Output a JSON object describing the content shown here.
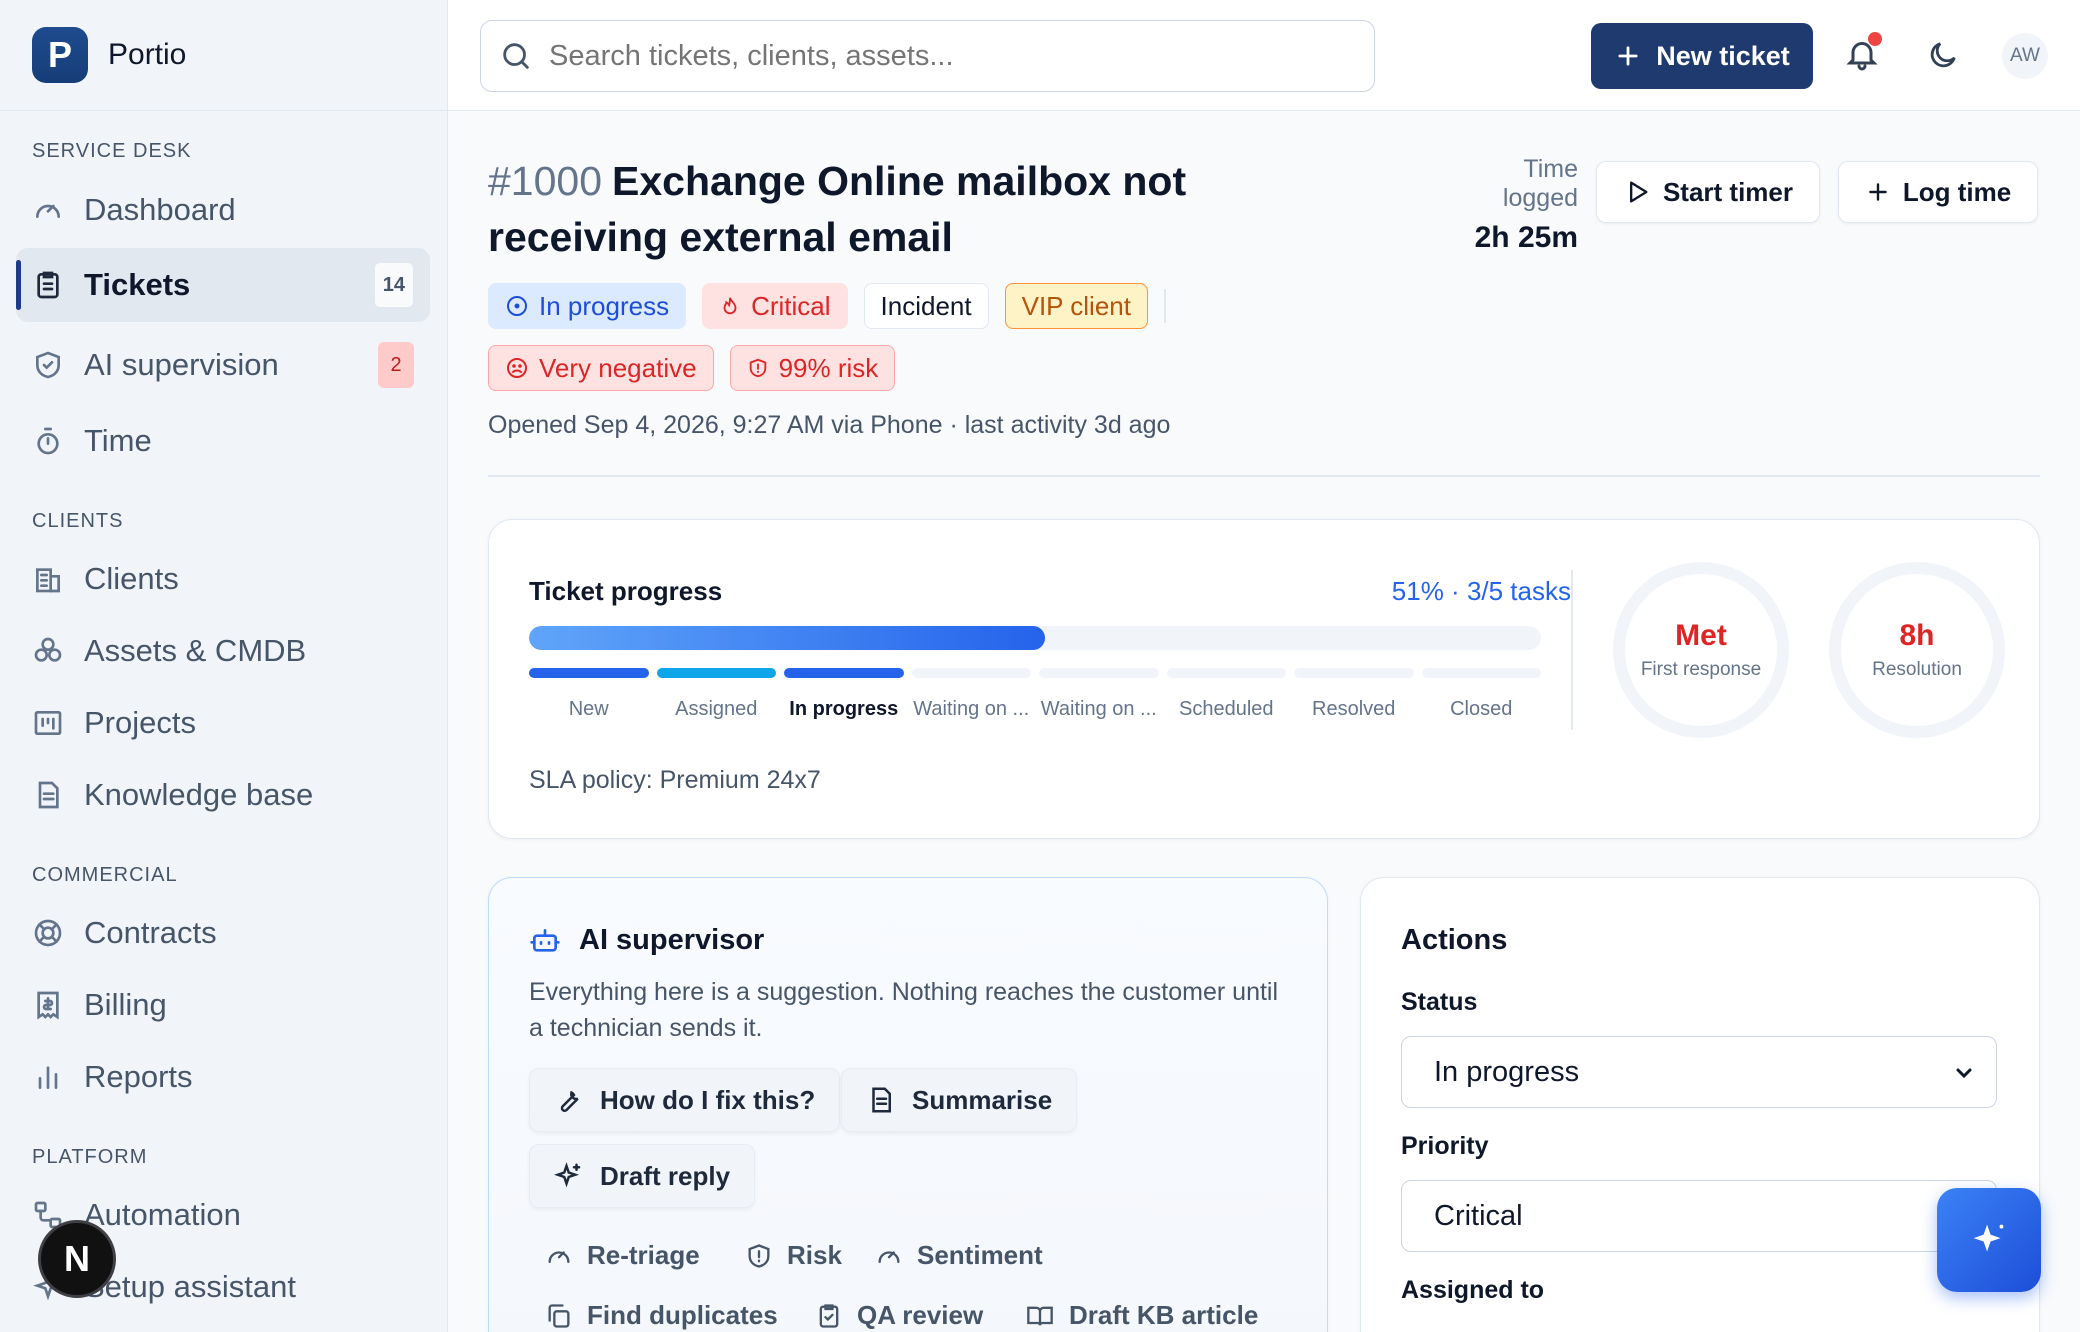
{
  "app": {
    "name": "Portio",
    "logo_letter": "P"
  },
  "sidebar": {
    "sections": [
      {
        "label": "SERVICE DESK",
        "items": [
          {
            "label": "Dashboard",
            "icon": "gauge-icon"
          },
          {
            "label": "Tickets",
            "icon": "clipboard-icon",
            "badge": "14",
            "active": true
          },
          {
            "label": "AI supervision",
            "icon": "shield-check-icon",
            "badge": "2"
          },
          {
            "label": "Time",
            "icon": "stopwatch-icon"
          }
        ]
      },
      {
        "label": "CLIENTS",
        "items": [
          {
            "label": "Clients",
            "icon": "building-icon"
          },
          {
            "label": "Assets & CMDB",
            "icon": "boxes-icon"
          },
          {
            "label": "Projects",
            "icon": "kanban-icon"
          },
          {
            "label": "Knowledge base",
            "icon": "document-icon"
          }
        ]
      },
      {
        "label": "COMMERCIAL",
        "items": [
          {
            "label": "Contracts",
            "icon": "lifebuoy-icon"
          },
          {
            "label": "Billing",
            "icon": "receipt-icon"
          },
          {
            "label": "Reports",
            "icon": "bar-chart-icon"
          }
        ]
      },
      {
        "label": "PLATFORM",
        "items": [
          {
            "label": "Automation",
            "icon": "workflow-icon"
          },
          {
            "label": "Setup assistant",
            "icon": "sparkle-icon"
          }
        ]
      }
    ],
    "user_badge": "N"
  },
  "header": {
    "search_placeholder": "Search tickets, clients, assets...",
    "new_ticket_label": "New ticket",
    "avatar_initials": "AW",
    "notification_dot_color": "#ef4444"
  },
  "ticket": {
    "number": "#1000",
    "title": "Exchange Online mailbox not receiving external email",
    "chips": {
      "status": "In progress",
      "priority": "Critical",
      "type": "Incident",
      "client_tier": "VIP client",
      "sentiment": "Very negative",
      "risk": "99% risk"
    },
    "meta": "Opened Sep 4, 2026, 9:27 AM via Phone · last activity 3d ago",
    "time_logged_label": "Time logged",
    "time_logged_value": "2h 25m",
    "start_timer_label": "Start timer",
    "log_time_label": "Log time"
  },
  "progress": {
    "title": "Ticket progress",
    "summary": "51% · 3/5 tasks",
    "percent": 51,
    "stages": [
      "New",
      "Assigned",
      "In progress",
      "Waiting on ...",
      "Waiting on ...",
      "Scheduled",
      "Resolved",
      "Closed"
    ],
    "current_stage_index": 2,
    "sla_policy": "SLA policy: Premium 24x7",
    "first_response": {
      "value": "Met",
      "label": "First response"
    },
    "resolution": {
      "value": "8h",
      "label": "Resolution"
    }
  },
  "ai_supervisor": {
    "title": "AI supervisor",
    "description": "Everything here is a suggestion. Nothing reaches the customer until a technician sends it.",
    "primary_actions": [
      "How do I fix this?",
      "Summarise",
      "Draft reply"
    ],
    "secondary_actions": [
      "Re-triage",
      "Risk",
      "Sentiment",
      "Find duplicates",
      "QA review",
      "Draft KB article"
    ]
  },
  "actions": {
    "title": "Actions",
    "status_label": "Status",
    "status_value": "In progress",
    "priority_label": "Priority",
    "priority_value": "Critical",
    "assigned_label": "Assigned to"
  },
  "colors": {
    "brand": "#1e3a6e",
    "accent": "#2563eb",
    "danger": "#dc2626"
  }
}
